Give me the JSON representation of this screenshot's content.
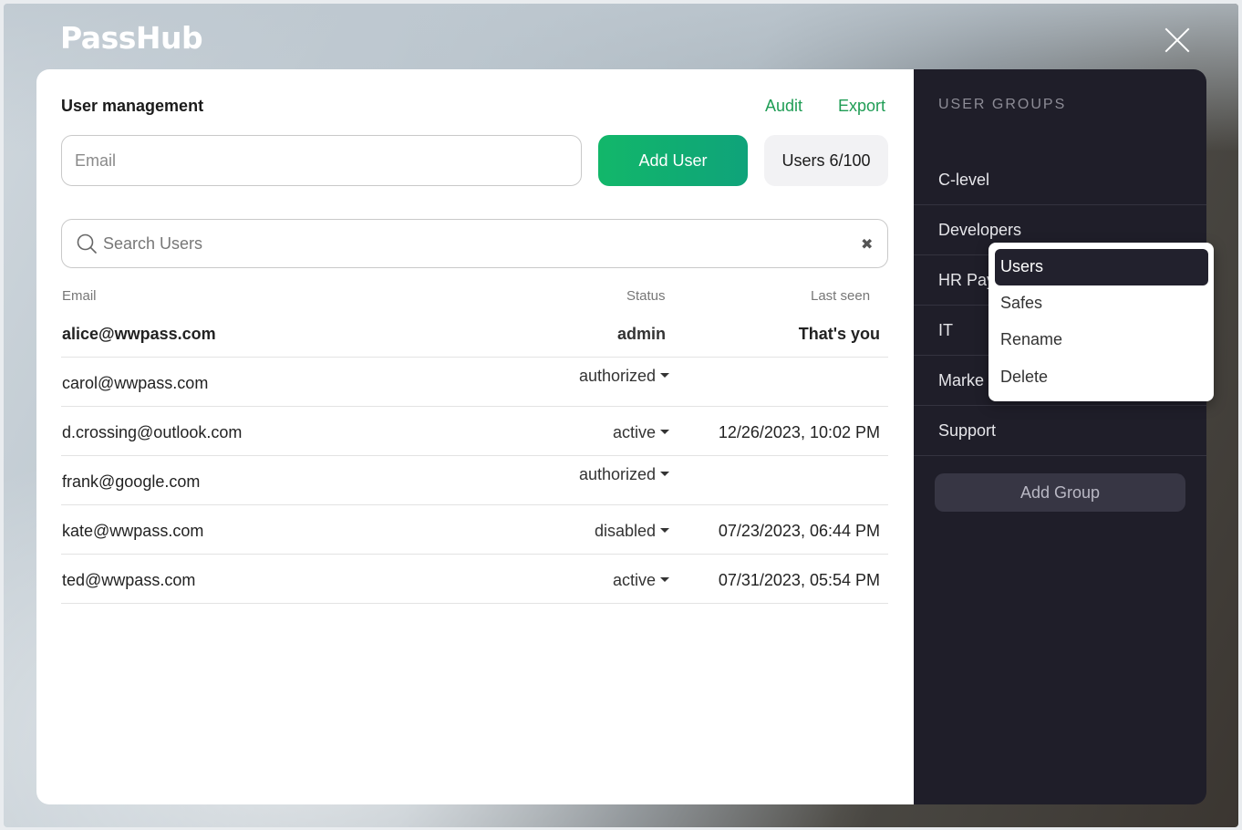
{
  "app": {
    "logo_text": "PassHub"
  },
  "header": {
    "close_icon": "close-icon"
  },
  "user_management": {
    "title": "User management",
    "audit_label": "Audit",
    "export_label": "Export",
    "email_placeholder": "Email",
    "add_user_label": "Add User",
    "users_count_label": "Users 6/100",
    "search_placeholder": "Search Users",
    "columns": {
      "email": "Email",
      "status": "Status",
      "last_seen": "Last seen"
    },
    "rows": [
      {
        "email": "alice@wwpass.com",
        "status": "admin",
        "last_seen": "That's you"
      },
      {
        "email": "carol@wwpass.com",
        "status": "authorized",
        "last_seen": ""
      },
      {
        "email": "d.crossing@outlook.com",
        "status": "active",
        "last_seen": "12/26/2023, 10:02 PM"
      },
      {
        "email": "frank@google.com",
        "status": "authorized",
        "last_seen": ""
      },
      {
        "email": "kate@wwpass.com",
        "status": "disabled",
        "last_seen": "07/23/2023, 06:44 PM"
      },
      {
        "email": "ted@wwpass.com",
        "status": "active",
        "last_seen": "07/31/2023, 05:54 PM"
      }
    ]
  },
  "user_groups": {
    "title": "USER GROUPS",
    "items": [
      {
        "label": "C-level"
      },
      {
        "label": "Developers"
      },
      {
        "label": "HR Pay"
      },
      {
        "label": "IT"
      },
      {
        "label": "Marke"
      },
      {
        "label": "Support"
      }
    ],
    "add_group_label": "Add Group"
  },
  "context_menu": {
    "items": [
      {
        "label": "Users",
        "active": true
      },
      {
        "label": "Safes",
        "active": false
      },
      {
        "label": "Rename",
        "active": false
      },
      {
        "label": "Delete",
        "active": false
      }
    ]
  },
  "colors": {
    "accent_green": "#1f9d55",
    "add_user_green": "#12b76a",
    "groups_panel_bg": "#1f1e29"
  }
}
